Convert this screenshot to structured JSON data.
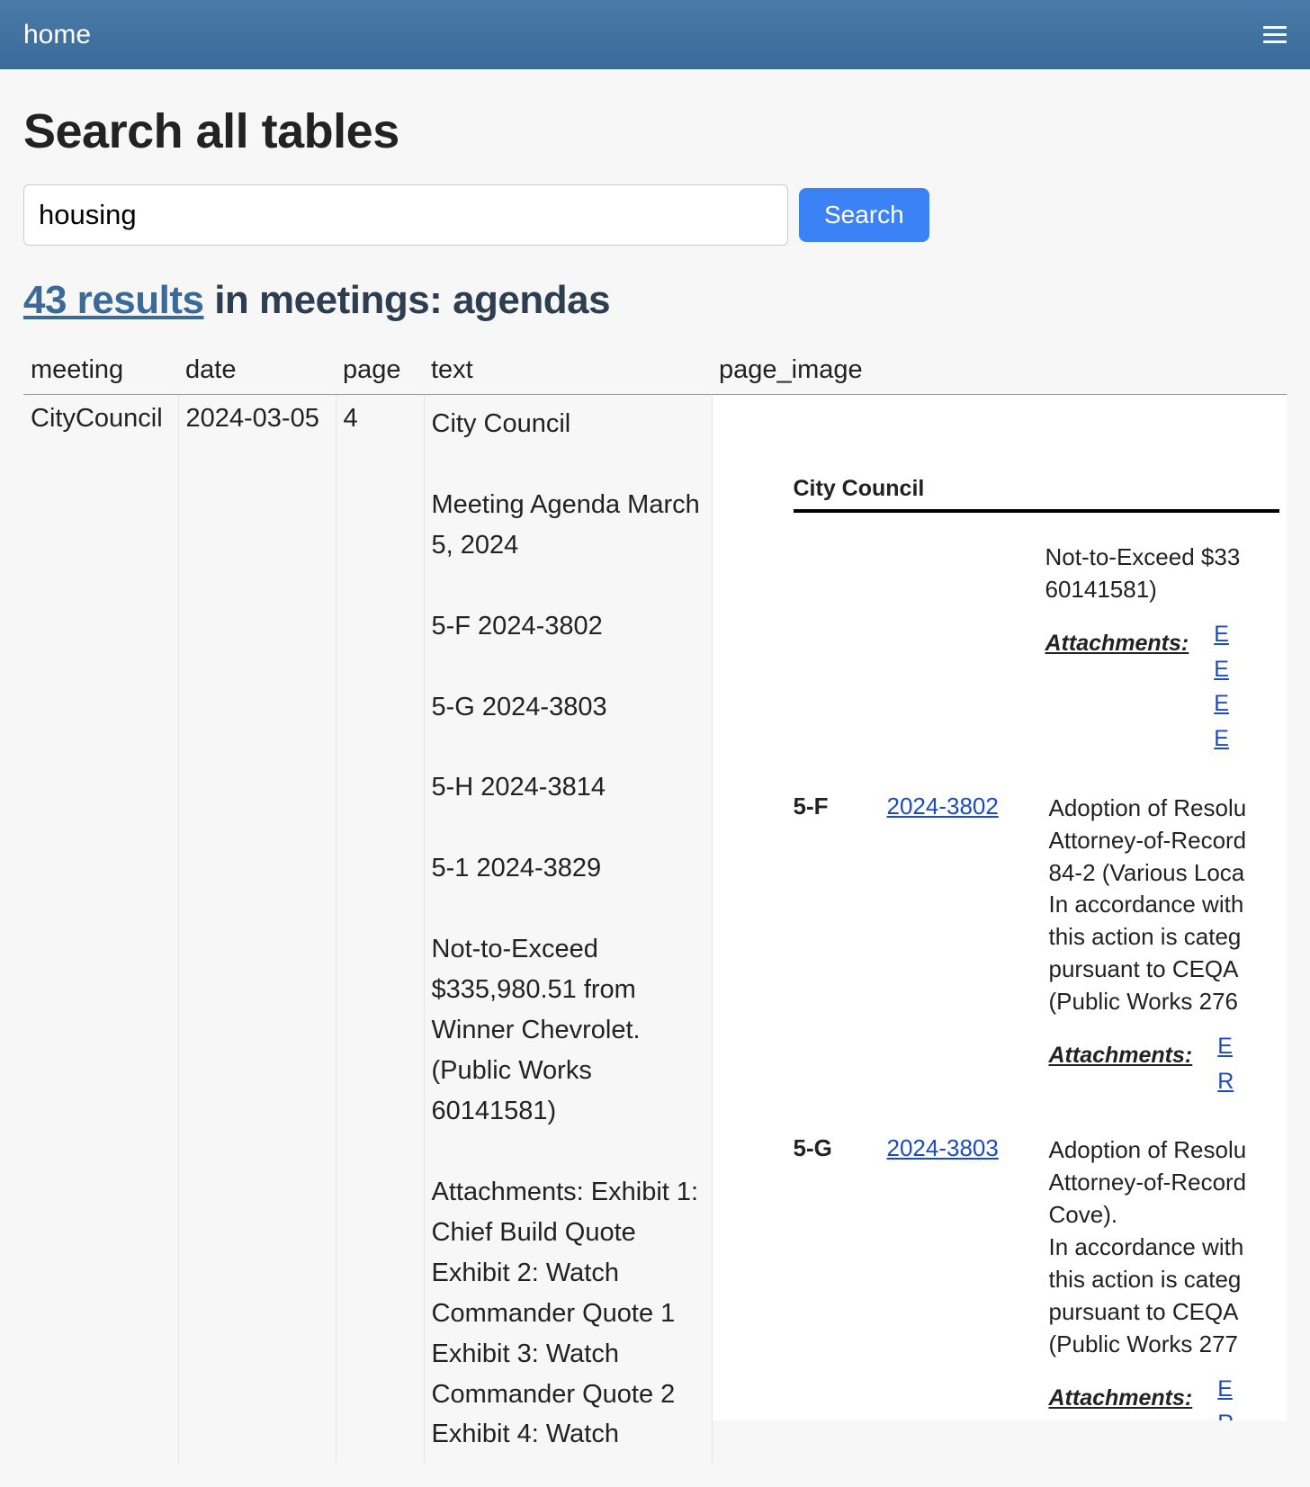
{
  "nav": {
    "home": "home"
  },
  "page": {
    "title": "Search all tables"
  },
  "search": {
    "value": "housing",
    "button": "Search"
  },
  "results": {
    "link_text": "43 results",
    "suffix": " in meetings: agendas"
  },
  "table": {
    "headers": {
      "meeting": "meeting",
      "date": "date",
      "page": "page",
      "text": "text",
      "page_image": "page_image"
    },
    "rows": [
      {
        "meeting": "CityCouncil",
        "date": "2024-03-05",
        "page": "4",
        "text": "City Council\n\nMeeting Agenda March 5, 2024\n\n5-F 2024-3802\n\n5-G 2024-3803\n\n5-H 2024-3814\n\n5-1 2024-3829\n\nNot-to-Exceed $335,980.51 from Winner Chevrolet. (Public Works 60141581)\n\nAttachments: Exhibit 1: Chief Build Quote Exhibit 2: Watch Commander Quote 1 Exhibit 3: Watch Commander Quote 2 Exhibit 4: Watch"
      }
    ]
  },
  "page_image": {
    "header": "City Council",
    "top_block": {
      "line1": "Not-to-Exceed $33",
      "line2": "60141581)",
      "attachments_label": "Attachments:",
      "elines": [
        "E",
        "E",
        "E",
        "E"
      ]
    },
    "items": [
      {
        "id": "5-F",
        "link": "2024-3802",
        "body": "Adoption of Resolu\nAttorney-of-Record\n84-2 (Various Loca\nIn accordance with\nthis action is categ\npursuant to CEQA\n(Public Works 276",
        "attachments_label": "Attachments:",
        "elines": [
          "E",
          "R"
        ]
      },
      {
        "id": "5-G",
        "link": "2024-3803",
        "body": "Adoption of Resolu\nAttorney-of-Record\nCove).\nIn accordance with\nthis action is categ\npursuant to CEQA\n(Public Works 277",
        "attachments_label": "Attachments:",
        "elines": [
          "E",
          "R"
        ]
      }
    ]
  }
}
